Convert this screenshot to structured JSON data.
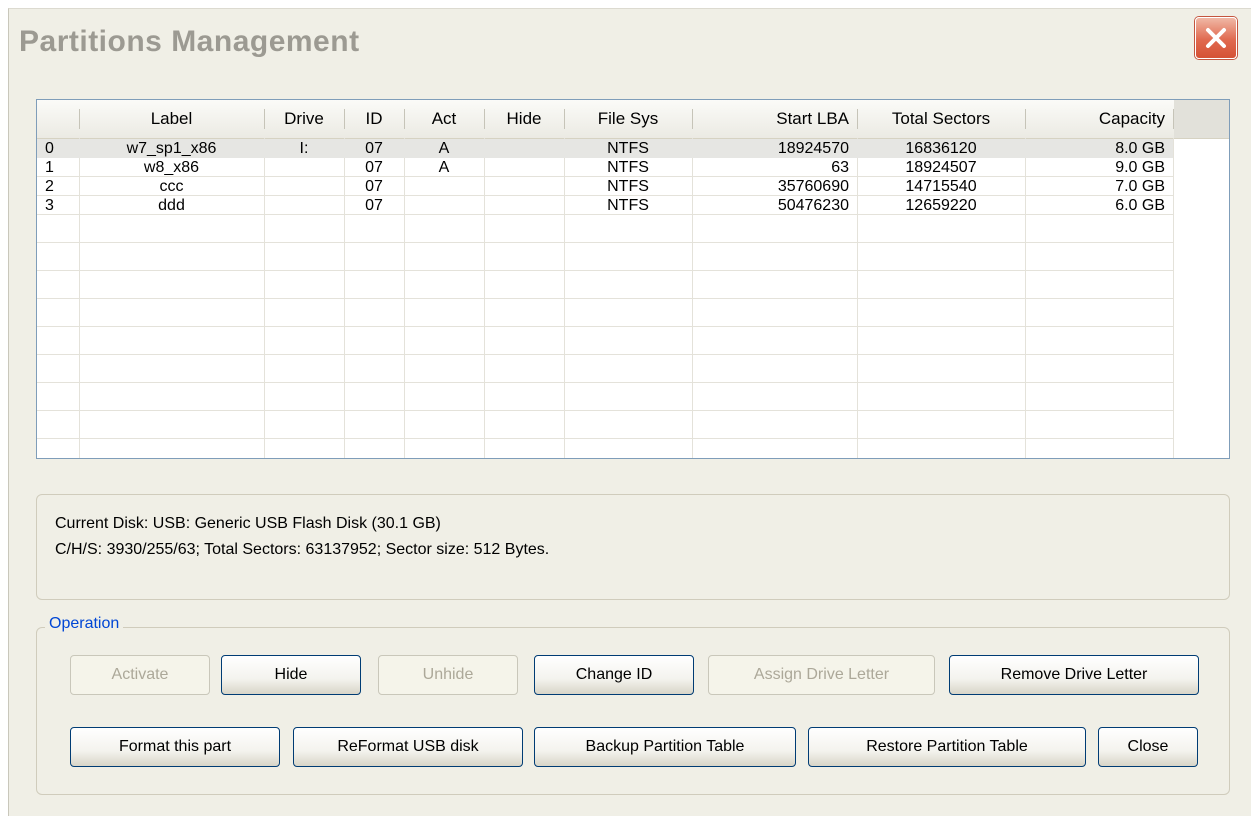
{
  "window": {
    "title": "Partitions Management"
  },
  "table": {
    "columns": [
      "",
      "Label",
      "Drive",
      "ID",
      "Act",
      "Hide",
      "File Sys",
      "Start LBA",
      "Total Sectors",
      "Capacity"
    ],
    "rows": [
      [
        "0",
        "w7_sp1_x86",
        "I:",
        "07",
        "A",
        "",
        "NTFS",
        "18924570",
        "16836120",
        "8.0 GB"
      ],
      [
        "1",
        "w8_x86",
        "",
        "07",
        "A",
        "",
        "NTFS",
        "63",
        "18924507",
        "9.0 GB"
      ],
      [
        "2",
        "ccc",
        "",
        "07",
        "",
        "",
        "NTFS",
        "35760690",
        "14715540",
        "7.0 GB"
      ],
      [
        "3",
        "ddd",
        "",
        "07",
        "",
        "",
        "NTFS",
        "50476230",
        "12659220",
        "6.0 GB"
      ]
    ],
    "selected_row": 0
  },
  "disk_info": {
    "line1": "Current Disk:   USB: Generic USB Flash Disk (30.1 GB)",
    "line2": "C/H/S: 3930/255/63; Total Sectors: 63137952; Sector size: 512 Bytes."
  },
  "operation": {
    "legend": "Operation",
    "activate": "Activate",
    "hide": "Hide",
    "unhide": "Unhide",
    "change_id": "Change ID",
    "assign_drive_letter": "Assign Drive Letter",
    "remove_drive_letter": "Remove Drive Letter",
    "format_part": "Format this part",
    "reformat_usb": "ReFormat USB disk",
    "backup_table": "Backup Partition Table",
    "restore_table": "Restore Partition Table",
    "close": "Close"
  },
  "icons": {
    "close": "close-icon"
  },
  "colors": {
    "close_button": "#e0694f",
    "legend": "#0046d5",
    "accent_border": "#003c74"
  }
}
